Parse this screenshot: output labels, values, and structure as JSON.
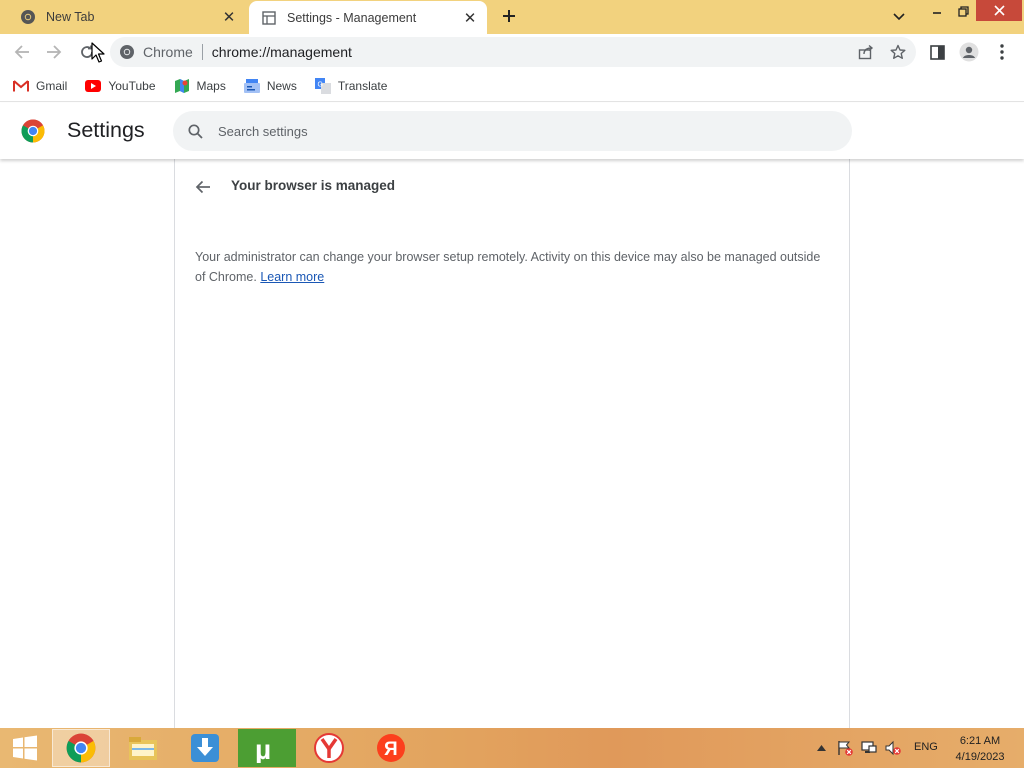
{
  "tabs": [
    {
      "title": "New Tab",
      "favicon": "chrome-icon"
    },
    {
      "title": "Settings - Management",
      "favicon": "document-icon",
      "active": true
    }
  ],
  "toolbar": {
    "site_label": "Chrome",
    "url": "chrome://management"
  },
  "bookmarks": [
    {
      "label": "Gmail",
      "icon": "gmail-icon"
    },
    {
      "label": "YouTube",
      "icon": "youtube-icon"
    },
    {
      "label": "Maps",
      "icon": "maps-icon"
    },
    {
      "label": "News",
      "icon": "news-icon"
    },
    {
      "label": "Translate",
      "icon": "translate-icon"
    }
  ],
  "settings": {
    "title": "Settings",
    "search_placeholder": "Search settings"
  },
  "management": {
    "heading": "Your browser is managed",
    "description": "Your administrator can change your browser setup remotely. Activity on this device may also be managed outside of Chrome.",
    "learn_more": "Learn more"
  },
  "taskbar": {
    "apps": [
      "chrome-icon",
      "file-explorer-icon",
      "download-manager-icon",
      "utorrent-icon",
      "yandex-browser-icon",
      "yandex-icon"
    ],
    "language": "ENG",
    "time": "6:21 AM",
    "date": "4/19/2023"
  },
  "colors": {
    "tabstrip": "#f2d27e",
    "link": "#1a57b5",
    "close_button": "#c7493a"
  }
}
